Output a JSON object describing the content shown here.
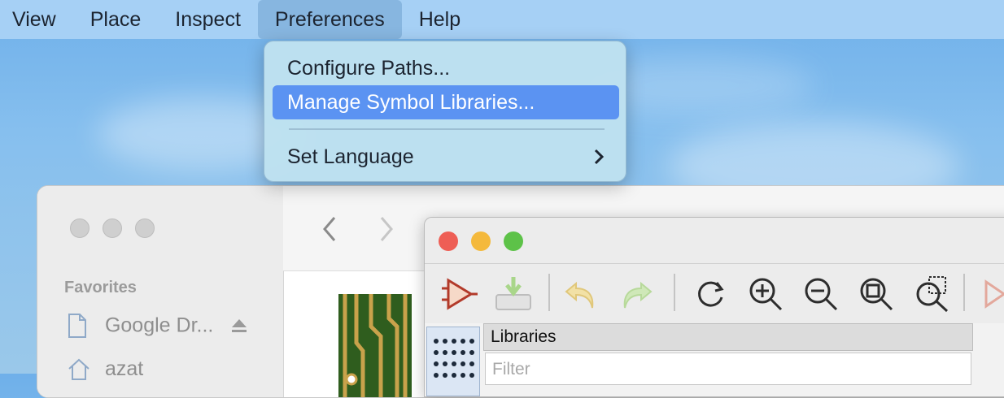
{
  "menubar": {
    "items": [
      "View",
      "Place",
      "Inspect",
      "Preferences",
      "Help"
    ],
    "active_index": 3
  },
  "dropdown": {
    "items": [
      {
        "label": "Configure Paths..."
      },
      {
        "label": "Manage Symbol Libraries..."
      },
      {
        "label": "Set Language",
        "submenu": true
      }
    ],
    "highlighted_index": 1,
    "submenu_icon": "chevron-right-icon"
  },
  "finder": {
    "section_label": "Favorites",
    "items": [
      {
        "label": "Google Dr...",
        "icon": "document-icon",
        "trailing_icon": "eject-icon"
      },
      {
        "label": "azat",
        "icon": "home-icon"
      }
    ],
    "nav": [
      "back-arrow-icon",
      "forward-arrow-icon"
    ]
  },
  "kicad": {
    "toolbar_icons": [
      "symbol-editor-icon",
      "save-to-library-icon",
      "undo-icon",
      "redo-icon",
      "refresh-icon",
      "zoom-in-icon",
      "zoom-out-icon",
      "zoom-fit-icon",
      "zoom-selection-icon",
      "pin-icon"
    ],
    "libraries_header": "Libraries",
    "filter_placeholder": "Filter"
  },
  "colors": {
    "highlight": "#5b93f2",
    "traffic_close": "#ee5e55",
    "traffic_minimize": "#f4b93c",
    "traffic_zoom": "#5dc248"
  }
}
